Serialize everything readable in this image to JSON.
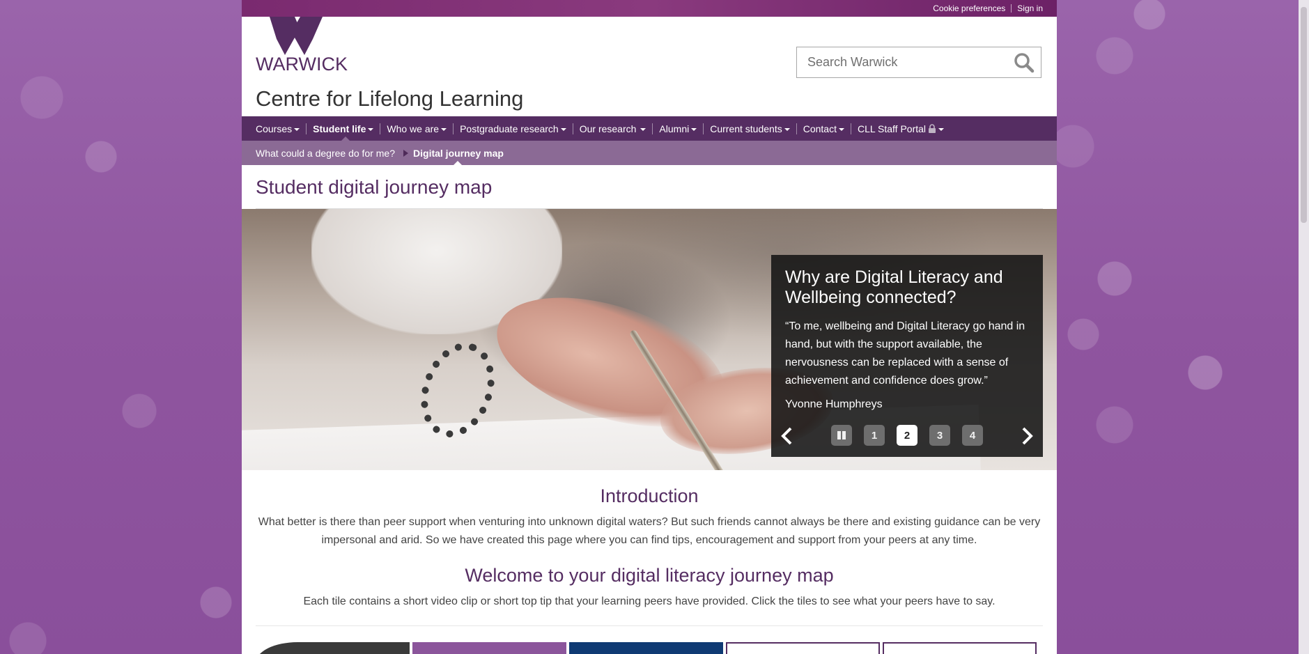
{
  "utility": {
    "cookie_preferences": "Cookie preferences",
    "sign_in": "Sign in"
  },
  "header": {
    "logo_text": "WARWICK",
    "site_title": "Centre for Lifelong Learning",
    "search_placeholder": "Search Warwick",
    "search_icon": "search-icon"
  },
  "nav": {
    "items": [
      {
        "label": "Courses"
      },
      {
        "label": "Student life"
      },
      {
        "label": "Who we are"
      },
      {
        "label": "Postgraduate research"
      },
      {
        "label": "Our research"
      },
      {
        "label": "Alumni"
      },
      {
        "label": "Current students"
      },
      {
        "label": "Contact"
      },
      {
        "label": "CLL Staff Portal"
      }
    ],
    "active_index": 1
  },
  "subnav": {
    "parent": "What could a degree do for me?",
    "current": "Digital journey map"
  },
  "page": {
    "title": "Student digital journey map"
  },
  "carousel": {
    "heading": "Why are Digital Literacy and Wellbeing connected?",
    "quote": "“To me, wellbeing and Digital Literacy go hand in hand, but with the support available, the nervousness can be replaced with a sense of achievement and confidence does grow.”",
    "author": "Yvonne Humphreys",
    "slides": [
      "1",
      "2",
      "3",
      "4"
    ],
    "active_slide": "2"
  },
  "intro": {
    "heading": "Introduction",
    "text": "What better is there than peer support when venturing into unknown digital waters? But such friends cannot always be there and existing guidance can be very impersonal and arid. So we have created this page where you can find tips, encouragement and support from your peers at any time."
  },
  "welcome": {
    "heading": "Welcome to your digital literacy journey map",
    "text": "Each tile contains a short video clip or short top tip that your learning peers have provided. Click the tiles to see what your peers have to say."
  },
  "colors": {
    "brand_purple": "#552d62",
    "subnav_purple": "#8b6a95",
    "background_purple": "#9a64ab"
  }
}
